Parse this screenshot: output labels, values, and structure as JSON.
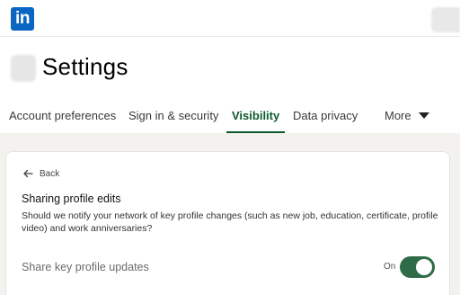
{
  "brand": {
    "logo_text": "in",
    "color": "#0a66c2"
  },
  "header": {
    "title": "Settings"
  },
  "tabs": [
    {
      "label": "Account preferences",
      "active": false
    },
    {
      "label": "Sign in & security",
      "active": false
    },
    {
      "label": "Visibility",
      "active": true
    },
    {
      "label": "Data privacy",
      "active": false
    }
  ],
  "more_label": "More",
  "card": {
    "back_label": "Back",
    "title": "Sharing profile edits",
    "description": "Should we notify your network of key profile changes (such as new job, education, certificate, profile video) and work anniversaries?",
    "setting_label": "Share key profile updates",
    "toggle_state": "On",
    "toggle_on": true
  },
  "colors": {
    "accent": "#0c5a2b",
    "toggle": "#2f6b46",
    "page_bg": "#f4f2ee"
  }
}
